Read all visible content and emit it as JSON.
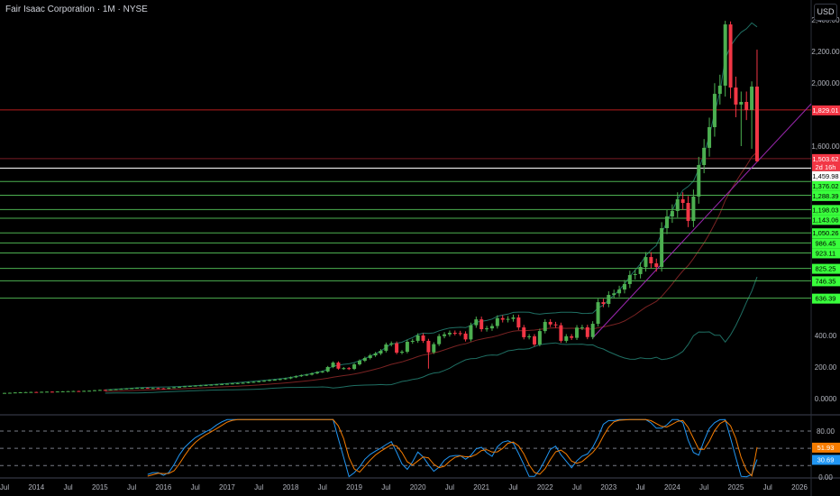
{
  "header": {
    "title": "Fair Isaac Corporation · 1M · NYSE",
    "currency_button": "USD"
  },
  "colors": {
    "up": "#4caf50",
    "down": "#f23645",
    "band": "#1f6f63",
    "basis": "#7a2323",
    "trend": "#9c27b0",
    "level": "#4caf50",
    "level_label": "#39ff3c",
    "resistance": "#b71c1c",
    "stoch_k": "#2196f3",
    "stoch_d": "#f57c00"
  },
  "chart_data": {
    "type": "candlestick",
    "title": "Fair Isaac Corporation · 1M · NYSE",
    "start": "2013-07",
    "interval": "1M",
    "closes": [
      36,
      37,
      39,
      40,
      41,
      42,
      41,
      43,
      44,
      43,
      45,
      46,
      47,
      48,
      47,
      49,
      50,
      53,
      55,
      54,
      58,
      60,
      62,
      64,
      66,
      68,
      68,
      66,
      67,
      65,
      64,
      68,
      72,
      74,
      78,
      80,
      82,
      84,
      86,
      88,
      90,
      92,
      94,
      96,
      98,
      100,
      104,
      106,
      110,
      113,
      118,
      120,
      124,
      128,
      135,
      142,
      148,
      152,
      160,
      168,
      172,
      200,
      228,
      190,
      193,
      188,
      217,
      240,
      257,
      274,
      286,
      303,
      343,
      350,
      291,
      297,
      360,
      366,
      400,
      366,
      293,
      345,
      396,
      407,
      417,
      415,
      412,
      375,
      465,
      502,
      440,
      445,
      460,
      510,
      500,
      505,
      514,
      451,
      389,
      395,
      343,
      428,
      486,
      470,
      465,
      366,
      395,
      385,
      450,
      452,
      390,
      474,
      611,
      600,
      657,
      667,
      691,
      726,
      783,
      789,
      834,
      897,
      857,
      834,
      1080,
      1154,
      1189,
      1263,
      1240,
      1126,
      1280,
      1480,
      1589,
      1720,
      1931,
      1983,
      2371,
      1971,
      1863,
      1880,
      1829,
      1977,
      1503.62
    ],
    "wick_overrides": [
      {
        "month": "2020-03",
        "low": 190
      },
      {
        "month": "2024-11",
        "high": 2394
      },
      {
        "month": "2024-12",
        "high": 2390
      },
      {
        "month": "2025-01",
        "low": 1783
      },
      {
        "month": "2025-02",
        "low": 1600
      },
      {
        "month": "2025-04",
        "low": 1583,
        "high": 2010
      },
      {
        "month": "2025-05",
        "high": 2211,
        "low": 1500
      }
    ],
    "y_axis": {
      "range": [
        -60,
        2440
      ],
      "ticks": [
        "2,400.00",
        "2,200.00",
        "2,000.00",
        "1,600.00",
        "400.00",
        "200.00",
        "0.0000"
      ],
      "tick_values": [
        2400,
        2200,
        2000,
        1600,
        400,
        200,
        0
      ]
    },
    "x_axis": {
      "labels": [
        "Jul",
        "2014",
        "Jul",
        "2015",
        "Jul",
        "2016",
        "Jul",
        "2017",
        "Jul",
        "2018",
        "Jul",
        "2019",
        "Jul",
        "2020",
        "Jul",
        "2021",
        "Jul",
        "2022",
        "Jul",
        "2023",
        "Jul",
        "2024",
        "Jul",
        "2025",
        "Jul",
        "2026"
      ]
    },
    "last_price": {
      "value": "1,503.62",
      "countdown": "2d 16h",
      "price": 1503.62
    },
    "resistance_level": {
      "value": "1,829.01",
      "price": 1829.01
    },
    "white_level": {
      "value": "1,459.98",
      "price": 1459.98
    },
    "levels": [
      {
        "value": "1,376.02",
        "price": 1376.02
      },
      {
        "value": "1,288.39",
        "price": 1288.39
      },
      {
        "value": "1,198.03",
        "price": 1198.03
      },
      {
        "value": "1,143.06",
        "price": 1143.06
      },
      {
        "value": "1,050.26",
        "price": 1050.26
      },
      {
        "value": "986.45",
        "price": 986.45
      },
      {
        "value": "923.11",
        "price": 923.11
      },
      {
        "value": "825.25",
        "price": 825.25
      },
      {
        "value": "746.35",
        "price": 746.35
      },
      {
        "value": "636.39",
        "price": 636.39
      }
    ],
    "trendline": {
      "points": [
        {
          "month": "2022-10",
          "price": 385
        },
        {
          "month": "2025-05",
          "price": 1500
        }
      ]
    },
    "bollinger": {
      "length": 20,
      "mult": 2
    },
    "oscillator": {
      "type": "stochastic-rsi",
      "range": [
        0,
        100
      ],
      "levels": [
        80,
        50,
        20
      ],
      "ticks": [
        "80.00",
        "0.00"
      ],
      "tick_values": [
        80,
        0
      ],
      "d_value": "51.93",
      "d": 51.93,
      "k_value": "30.69",
      "k": 30.69
    }
  }
}
